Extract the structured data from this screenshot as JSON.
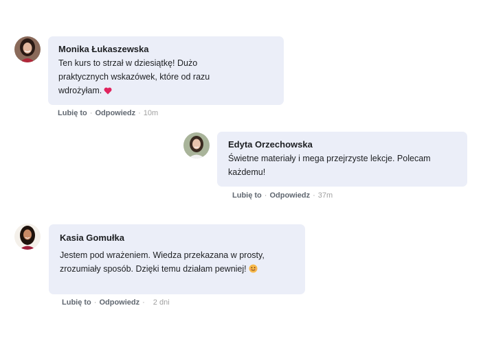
{
  "comments": [
    {
      "author": "Monika Łukaszewska",
      "text": "Ten kurs to strzał w dziesiątkę! Dużo praktycznych wskazówek, które od razu wdrożyłam.",
      "emoji": "heart-emoji",
      "like_label": "Lubię to",
      "reply_label": "Odpowiedz",
      "time": "10m"
    },
    {
      "author": "Edyta Orzechowska",
      "text": "Świetne materiały i mega przejrzyste lekcje. Polecam każdemu!",
      "like_label": "Lubię to",
      "reply_label": "Odpowiedz",
      "time": "37m"
    },
    {
      "author": "Kasia Gomułka",
      "text": "Jestem pod wrażeniem. Wiedza przekazana w prosty, zrozumiały sposób. Dzięki temu działam pewniej!",
      "emoji": "smile-emoji",
      "like_label": "Lubię to",
      "reply_label": "Odpowiedz",
      "time": "2 dni"
    }
  ],
  "colors": {
    "bubble": "#ebeef8",
    "heart": "#e0245e",
    "smile": "#f7b84b"
  }
}
